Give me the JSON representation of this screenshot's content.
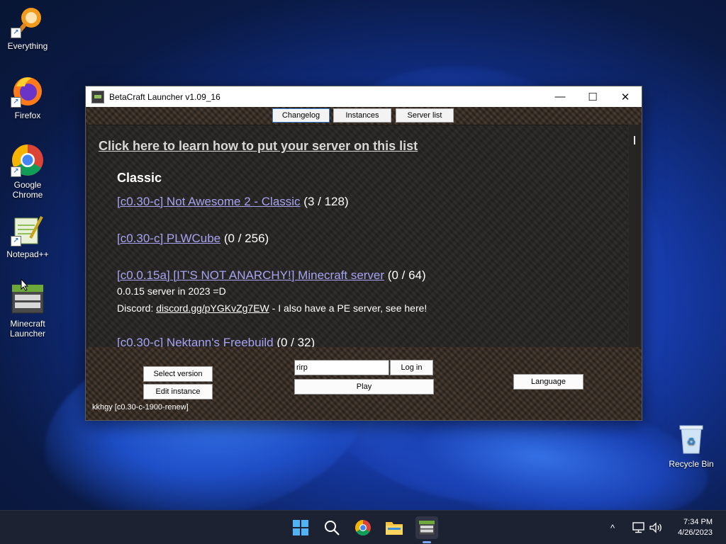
{
  "desktop": {
    "icons": [
      {
        "label": "Everything",
        "icon": "everything-search-icon"
      },
      {
        "label": "Firefox",
        "icon": "firefox-icon"
      },
      {
        "label": "Google Chrome",
        "icon": "chrome-icon"
      },
      {
        "label": "Notepad++",
        "icon": "notepad-plus-plus-icon"
      },
      {
        "label": "Minecraft Launcher",
        "icon": "betacraft-icon"
      },
      {
        "label": "Recycle Bin",
        "icon": "recycle-bin-icon"
      }
    ]
  },
  "window": {
    "title": "BetaCraft Launcher v1.09_16",
    "controls": {
      "minimize": "—",
      "maximize": "☐",
      "close": "✕"
    },
    "tabs": [
      {
        "label": "Changelog",
        "active": true
      },
      {
        "label": "Instances",
        "active": false
      },
      {
        "label": "Server list",
        "active": false
      }
    ],
    "content": {
      "learn_link": "Click here to learn how to put your server on this list",
      "category": "Classic",
      "servers": [
        {
          "name": "[c0.30-c] Not Awesome 2 - Classic",
          "players": "(3 / 128)"
        },
        {
          "name": "[c0.30-c] PLWCube",
          "players": "(0 / 256)"
        },
        {
          "name": "[c0.0.15a] [IT'S NOT ANARCHY!] Minecraft server",
          "players": "(0 / 64)",
          "description_line1": "0.0.15 server in 2023 =D",
          "description_line2_prefix": "Discord: ",
          "description_line2_link": "discord.gg/pYGKvZg7EW",
          "description_line2_suffix": " - I also have a PE server, see here!"
        },
        {
          "name": "[c0.30-c] Nektann's Freebuild",
          "players": "(0 / 32)"
        }
      ]
    },
    "bottom": {
      "select_version": "Select version",
      "edit_instance": "Edit instance",
      "username_value": "rirp",
      "login": "Log in",
      "play": "Play",
      "language": "Language",
      "status": "kkhgy [c0.30-c-1900-renew]"
    }
  },
  "taskbar": {
    "apps": [
      "start-icon",
      "search-icon",
      "chrome-icon",
      "file-explorer-icon",
      "betacraft-icon"
    ],
    "tray": {
      "chevron": "^",
      "time": "7:34 PM",
      "date": "4/26/2023"
    }
  },
  "colors": {
    "link": "#a7a3f2",
    "content_bg": "#262523",
    "taskbar_bg": "#1d2233"
  }
}
